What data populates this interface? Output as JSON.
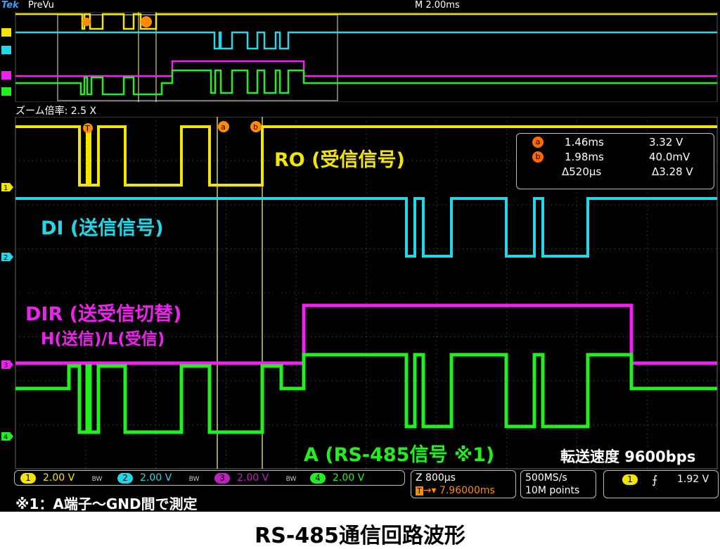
{
  "header": {
    "brand": "Tek",
    "mode": "PreVu",
    "timebase": "M 2.00ms"
  },
  "zoom": {
    "label": "ズーム倍率: 2.5 X"
  },
  "cursors": {
    "a_marker": "a",
    "b_marker": "b",
    "t_marker": "T"
  },
  "measurements": {
    "a": {
      "time": "1.46ms",
      "value": "3.32 V"
    },
    "b": {
      "time": "1.98ms",
      "value": "40.0mV"
    },
    "delta": {
      "time": "Δ520µs",
      "value": "Δ3.28 V"
    }
  },
  "channels": {
    "ro": {
      "label": "RO (受信信号)",
      "num": "1",
      "color": "#f2e600"
    },
    "di": {
      "label": "DI (送信信号)",
      "num": "2",
      "color": "#22d8e6"
    },
    "dir": {
      "label": "DIR (送受信切替)",
      "sub": "H(送信)/L(受信)",
      "num": "3",
      "color": "#ee22ee"
    },
    "a": {
      "label": "A (RS-485信号 ※1)",
      "num": "4",
      "color": "#22ee22"
    }
  },
  "baud": "転送速度 9600bps",
  "statusbar": {
    "ch1": {
      "num": "1",
      "scale": "2.00 V"
    },
    "ch2": {
      "num": "2",
      "scale": "2.00 V"
    },
    "ch3": {
      "num": "3",
      "scale": "2.00 V"
    },
    "ch4": {
      "num": "4",
      "scale": "2.00 V"
    },
    "bw": "BW",
    "zoom_time": "Z 800µs",
    "trigger_pos": "7.96000ms",
    "sample_rate": "500MS/s",
    "record": "10M points",
    "trig_ch": "1",
    "trig_level": "1.92 V"
  },
  "note": "※1：A端子～GND間で測定",
  "caption": "RS-485通信回路波形"
}
